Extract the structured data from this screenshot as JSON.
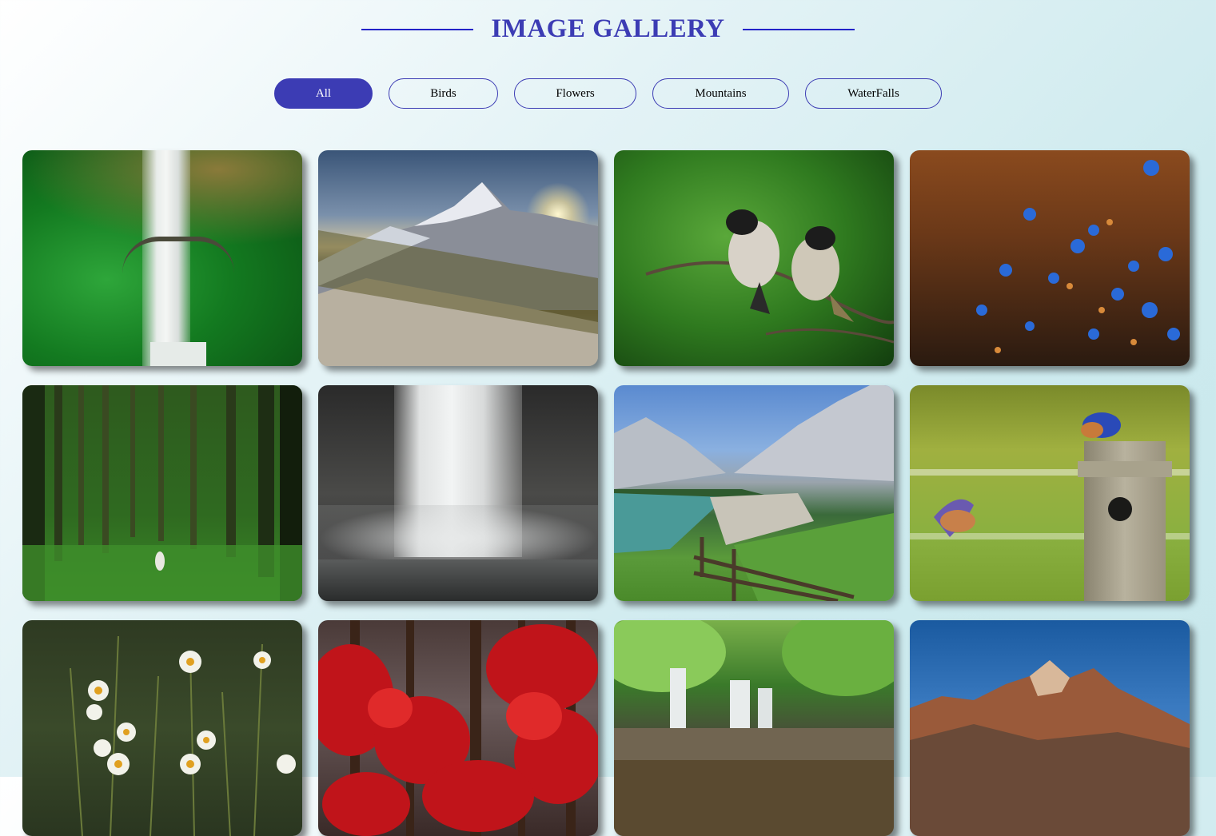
{
  "header": {
    "title": "IMAGE GALLERY"
  },
  "filters": [
    {
      "label": "All",
      "active": true
    },
    {
      "label": "Birds",
      "active": false
    },
    {
      "label": "Flowers",
      "active": false
    },
    {
      "label": "Mountains",
      "active": false
    },
    {
      "label": "WaterFalls",
      "active": false
    }
  ],
  "gallery": [
    {
      "subject": "waterfall with arch bridge in green forest",
      "category": "WaterFalls"
    },
    {
      "subject": "snowy mountain peaks at sunrise",
      "category": "Mountains"
    },
    {
      "subject": "two birds perched on a branch",
      "category": "Birds"
    },
    {
      "subject": "blue wildflowers in a brown field",
      "category": "Flowers"
    },
    {
      "subject": "tall green forest with walking person",
      "category": "All"
    },
    {
      "subject": "large waterfall over dark rocks",
      "category": "WaterFalls"
    },
    {
      "subject": "alpine lake with mountains and fence",
      "category": "Mountains"
    },
    {
      "subject": "bluebirds at a wooden birdhouse",
      "category": "Birds"
    },
    {
      "subject": "white daisies in tall grass",
      "category": "Flowers"
    },
    {
      "subject": "red autumn trees in forest",
      "category": "All"
    },
    {
      "subject": "small cascade into a forest pool",
      "category": "WaterFalls"
    },
    {
      "subject": "rugged mountain range under blue sky",
      "category": "Mountains"
    }
  ]
}
